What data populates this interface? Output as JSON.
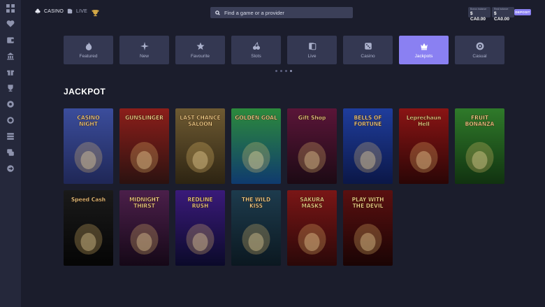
{
  "sidebar": {
    "icons": [
      "dashboard-icon",
      "heart-icon",
      "wallet-icon",
      "bank-icon",
      "gift-icon",
      "trophy-icon",
      "settings-icon",
      "support-icon",
      "list-icon",
      "chat-icon",
      "logout-icon"
    ]
  },
  "topbar": {
    "casino_label": "CASINO",
    "live_label": "LIVE",
    "search_placeholder": "Find a game or a provider",
    "bonus_balance_label": "Bonus balance",
    "bonus_balance_value": "$ CA0.00",
    "real_balance_label": "Real balance",
    "real_balance_value": "$ CA0.00",
    "deposit_label": "DEPOSIT"
  },
  "categories": [
    {
      "label": "Featured",
      "icon": "flame-icon",
      "active": false
    },
    {
      "label": "New",
      "icon": "sparkle-icon",
      "active": false
    },
    {
      "label": "Favourite",
      "icon": "star-icon",
      "active": false
    },
    {
      "label": "Slots",
      "icon": "cherry-icon",
      "active": false
    },
    {
      "label": "Live",
      "icon": "cards-icon",
      "active": false
    },
    {
      "label": "Casino",
      "icon": "dice-icon",
      "active": false
    },
    {
      "label": "Jackpots",
      "icon": "crown-icon",
      "active": true
    },
    {
      "label": "Casual",
      "icon": "chip-icon",
      "active": false
    }
  ],
  "carousel_dots": 4,
  "carousel_active_dot": 3,
  "section": {
    "title": "JACKPOT"
  },
  "games": [
    {
      "title": "CASINO NIGHT",
      "colors": [
        "#3b4d9c",
        "#1f2756"
      ]
    },
    {
      "title": "GUNSLINGER",
      "colors": [
        "#8c1e1a",
        "#2b1210"
      ]
    },
    {
      "title": "LAST CHANCE SALOON",
      "colors": [
        "#6e5a32",
        "#2d2412"
      ]
    },
    {
      "title": "GOLDEN GOAL",
      "colors": [
        "#2c8a3c",
        "#0f3a6e"
      ]
    },
    {
      "title": "Gift Shop",
      "colors": [
        "#5a1538",
        "#1c0a14"
      ]
    },
    {
      "title": "BELLS OF FORTUNE",
      "colors": [
        "#1f3d9c",
        "#0b1747"
      ]
    },
    {
      "title": "Leprechaun Hell",
      "colors": [
        "#8a1414",
        "#2a0606"
      ]
    },
    {
      "title": "FRUIT BONANZA",
      "colors": [
        "#2f7a2a",
        "#113210"
      ]
    },
    {
      "title": "Speed Cash",
      "colors": [
        "#1a1a1a",
        "#050505"
      ]
    },
    {
      "title": "MIDNIGHT THIRST",
      "colors": [
        "#4b1f4a",
        "#150817"
      ]
    },
    {
      "title": "REDLINE RUSH",
      "colors": [
        "#3a1a7a",
        "#0b0a2a"
      ]
    },
    {
      "title": "THE WILD KISS",
      "colors": [
        "#1d3b4d",
        "#0b1820"
      ]
    },
    {
      "title": "SAKURA MASKS",
      "colors": [
        "#7a1616",
        "#2a0808"
      ]
    },
    {
      "title": "PLAY WITH THE DEVIL",
      "colors": [
        "#5a1010",
        "#1a0404"
      ]
    }
  ],
  "colors": {
    "accent": "#8a80f2",
    "background": "#1b1d2c",
    "sidebar": "#25283b",
    "tile": "#343852"
  }
}
